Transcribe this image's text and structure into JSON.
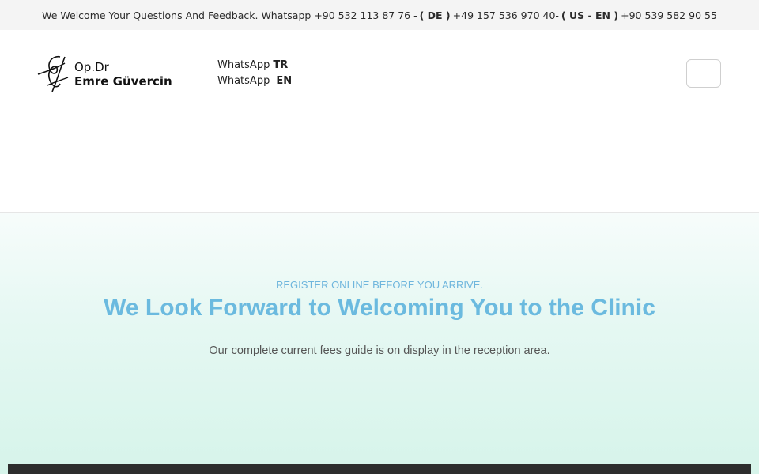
{
  "topbar": {
    "intro": "We Welcome Your Questions And Feedback. Whatsapp +90 532 113 87 76 -",
    "de_label": "( DE )",
    "de_number": "+49 157 536 970 40-",
    "us_label": "( US - EN )",
    "us_number": "+90 539 582 90 55"
  },
  "logo": {
    "line1": "Op.Dr",
    "line2": "Emre Güvercin"
  },
  "whatsapp": [
    {
      "label": "WhatsApp",
      "lang": "TR"
    },
    {
      "label": "WhatsApp",
      "lang": "EN"
    }
  ],
  "icons": {
    "menu": "hamburger-menu-icon",
    "logo": "signature-logo-icon"
  },
  "hero": {
    "kicker": "REGISTER ONLINE BEFORE YOU ARRIVE.",
    "title": "We Look Forward to Welcoming You to the Clinic",
    "subtitle": "Our complete current fees guide is on display in the reception area."
  },
  "colors": {
    "accent": "#6bbadf",
    "hero_bg": "#e6f8f3",
    "dark_bar": "#2d2d2d"
  }
}
